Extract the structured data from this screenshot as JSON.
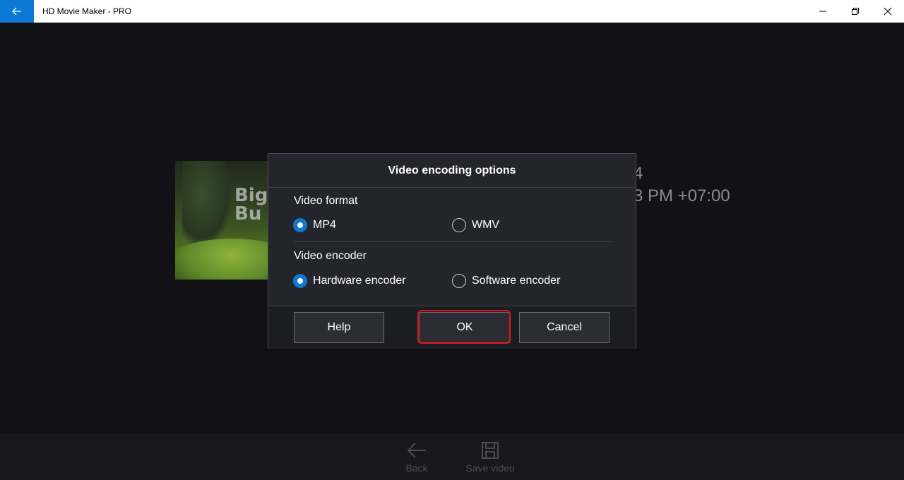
{
  "titlebar": {
    "title": "HD Movie Maker - PRO",
    "back_icon": "arrow-left-icon",
    "controls": [
      "minimize-icon",
      "restore-icon",
      "close-icon"
    ]
  },
  "background": {
    "thumbnail_logo": "Big\nBu",
    "info_line_1": "4",
    "info_line_2": "3 PM +07:00"
  },
  "dialog": {
    "title": "Video encoding options",
    "video_format": {
      "label": "Video format",
      "options": [
        {
          "label": "MP4",
          "selected": true
        },
        {
          "label": "WMV",
          "selected": false
        }
      ]
    },
    "video_encoder": {
      "label": "Video encoder",
      "options": [
        {
          "label": "Hardware encoder",
          "selected": true
        },
        {
          "label": "Software encoder",
          "selected": false
        }
      ]
    },
    "buttons": {
      "help": "Help",
      "ok": "OK",
      "cancel": "Cancel"
    }
  },
  "bottombar": {
    "back_label": "Back",
    "save_label": "Save video"
  },
  "colors": {
    "accent": "#0a78d4",
    "highlight": "#e2141c",
    "background": "#111116",
    "dialog": "#24252c"
  }
}
